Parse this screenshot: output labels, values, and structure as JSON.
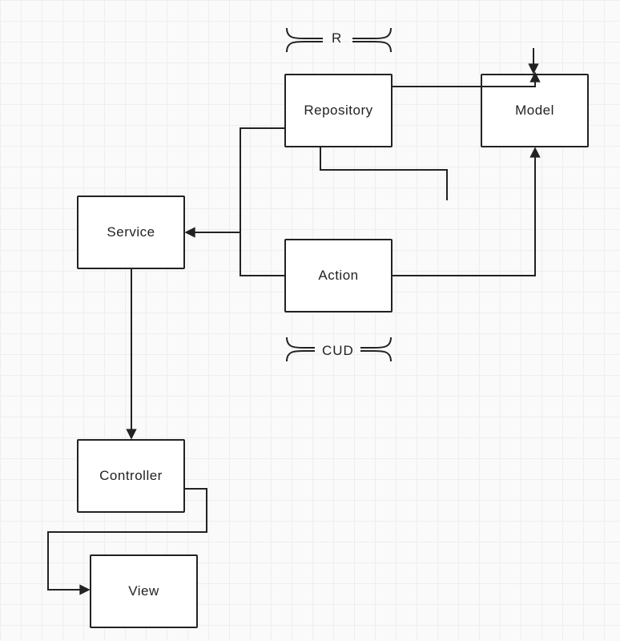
{
  "nodes": {
    "repository": {
      "label": "Repository"
    },
    "model": {
      "label": "Model"
    },
    "service": {
      "label": "Service"
    },
    "action": {
      "label": "Action"
    },
    "controller": {
      "label": "Controller"
    },
    "view": {
      "label": "View"
    }
  },
  "annotations": {
    "r": {
      "text": "R"
    },
    "cud": {
      "text": "CUD"
    }
  },
  "edges": [
    {
      "from": "repository",
      "to": "model",
      "kind": "read"
    },
    {
      "from": "action",
      "to": "model",
      "kind": "write"
    },
    {
      "from": "repository",
      "to": "service",
      "kind": "provides"
    },
    {
      "from": "action",
      "to": "service",
      "kind": "provides"
    },
    {
      "from": "service",
      "to": "controller",
      "kind": "uses"
    },
    {
      "from": "controller",
      "to": "view",
      "kind": "renders"
    }
  ]
}
